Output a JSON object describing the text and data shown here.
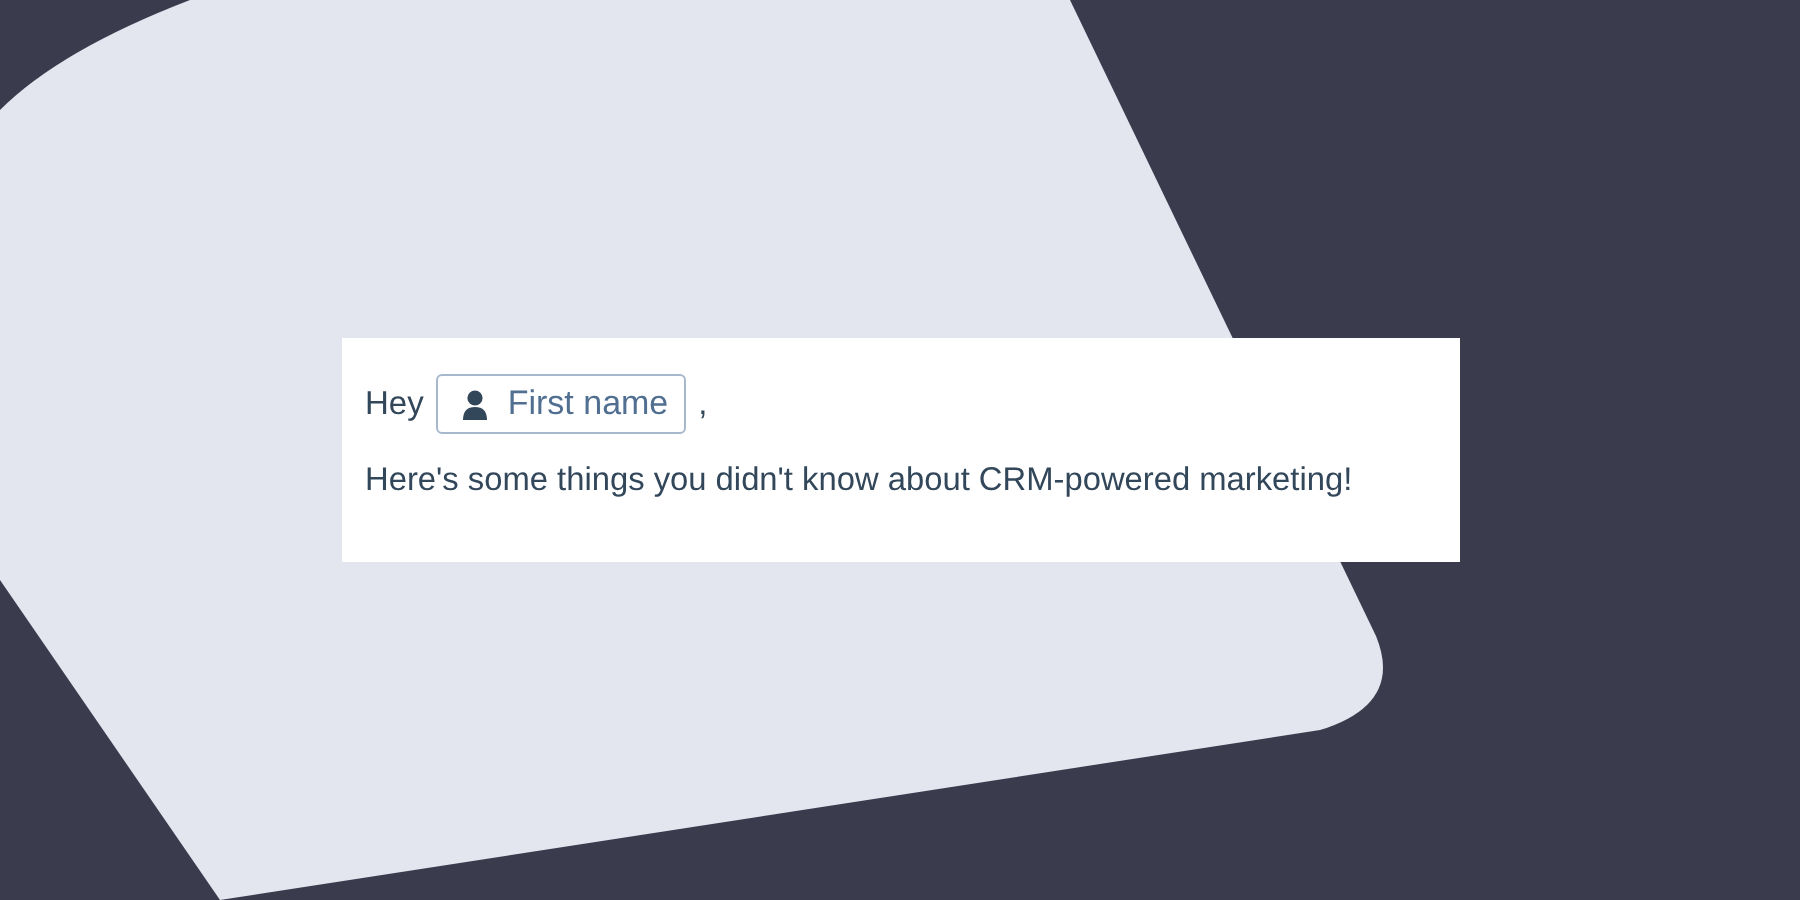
{
  "greeting": {
    "word": "Hey",
    "token": {
      "label": "First name"
    },
    "punctuation": ","
  },
  "body_text": "Here's some things you didn't know about CRM-powered marketing!"
}
